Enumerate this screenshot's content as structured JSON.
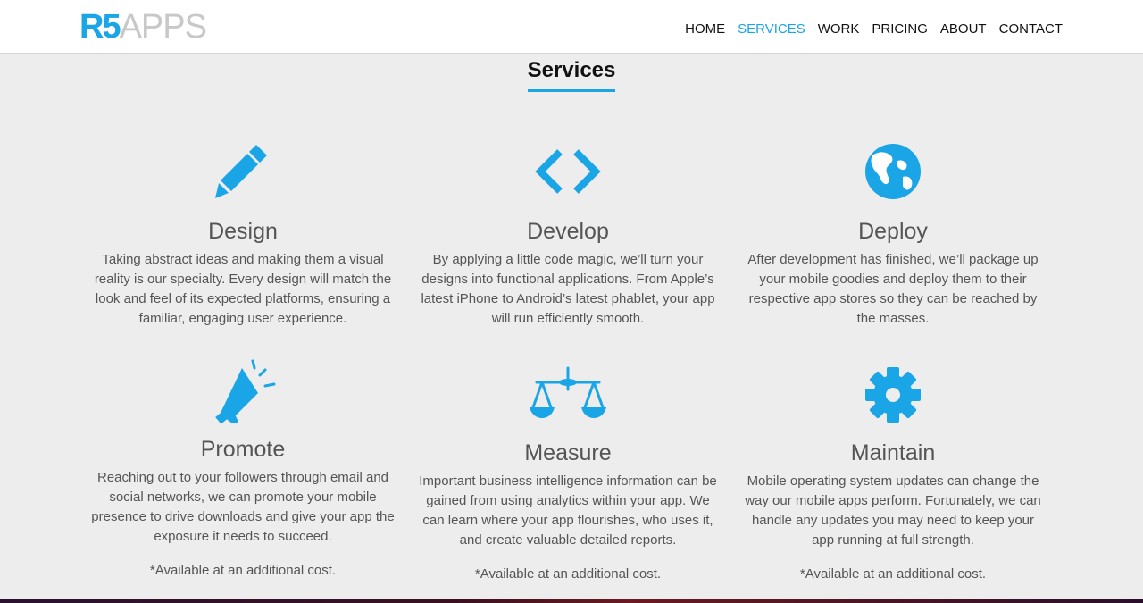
{
  "brand": {
    "mark": "R5",
    "word": "APPS",
    "accent": "#1aa5e6"
  },
  "nav": {
    "items": [
      {
        "label": "HOME"
      },
      {
        "label": "SERVICES",
        "active": true
      },
      {
        "label": "WORK"
      },
      {
        "label": "PRICING"
      },
      {
        "label": "ABOUT"
      },
      {
        "label": "CONTACT"
      }
    ]
  },
  "services": {
    "title": "Services",
    "items": [
      {
        "icon": "pencil-icon",
        "title": "Design",
        "text": "Taking abstract ideas and making them a visual reality is our specialty. Every design will match the look and feel of its expected platforms, ensuring a familiar, engaging user experience."
      },
      {
        "icon": "code-icon",
        "title": "Develop",
        "text": "By applying a little code magic, we’ll turn your designs into functional applications. From Apple’s latest iPhone to Android’s latest phablet, your app will run efficiently smooth."
      },
      {
        "icon": "globe-icon",
        "title": "Deploy",
        "text": "After development has finished, we’ll package up your mobile goodies and deploy them to their respective app stores so they can be reached by the masses."
      },
      {
        "icon": "megaphone-icon",
        "title": "Promote",
        "text": "Reaching out to your followers through email and social networks, we can promote your mobile presence to drive downloads and give your app the exposure it needs to succeed.",
        "note": "*Available at an additional cost."
      },
      {
        "icon": "scales-icon",
        "title": "Measure",
        "text": "Important business intelligence information can be gained from using analytics within your app. We can learn where your app flourishes, who uses it, and create valuable detailed reports.",
        "note": "*Available at an additional cost."
      },
      {
        "icon": "gear-icon",
        "title": "Maintain",
        "text": "Mobile operating system updates can change the way our mobile apps perform. Fortunately, we can handle any updates you may need to keep your app running at full strength.",
        "note": "*Available at an additional cost."
      }
    ]
  }
}
